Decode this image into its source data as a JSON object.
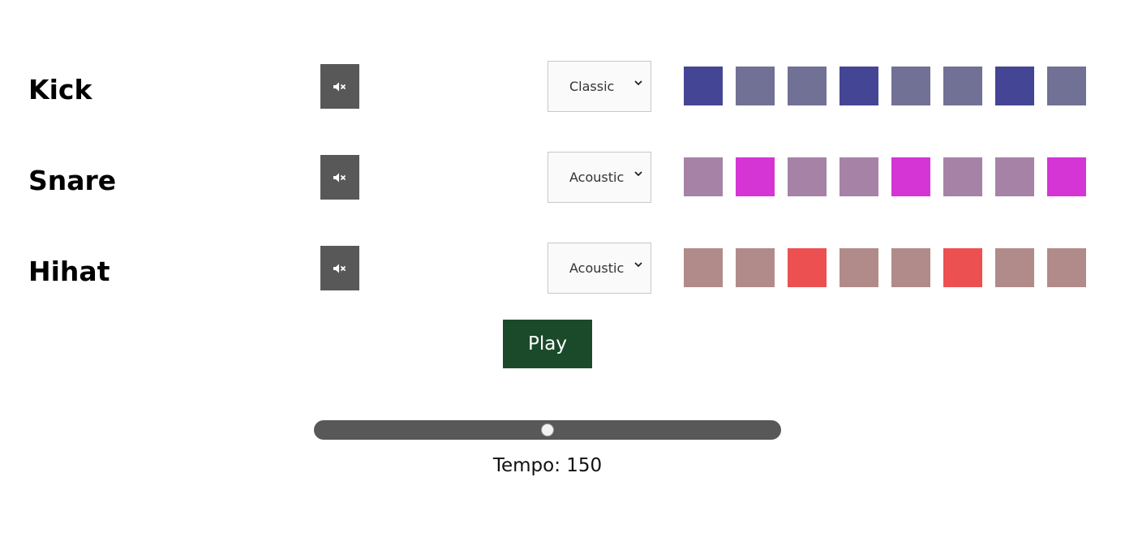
{
  "tracks": [
    {
      "name": "Kick",
      "kit": "Classic",
      "mute_icon": "speaker-muted-icon",
      "steps": [
        true,
        false,
        false,
        true,
        false,
        false,
        true,
        false
      ],
      "on_color": "#454595",
      "off_color": "#717195"
    },
    {
      "name": "Snare",
      "kit": "Acoustic",
      "mute_icon": "speaker-muted-icon",
      "steps": [
        false,
        true,
        false,
        false,
        true,
        false,
        false,
        true
      ],
      "on_color": "#d535d5",
      "off_color": "#a782a7"
    },
    {
      "name": "Hihat",
      "kit": "Acoustic",
      "mute_icon": "speaker-muted-icon",
      "steps": [
        false,
        false,
        true,
        false,
        false,
        true,
        false,
        false
      ],
      "on_color": "#ec5050",
      "off_color": "#b18b89"
    }
  ],
  "transport": {
    "play_label": "Play",
    "play_color": "#1b4a2a"
  },
  "tempo": {
    "label_prefix": "Tempo: ",
    "value": 150,
    "min": 30,
    "max": 270,
    "label": "Tempo: 150"
  }
}
